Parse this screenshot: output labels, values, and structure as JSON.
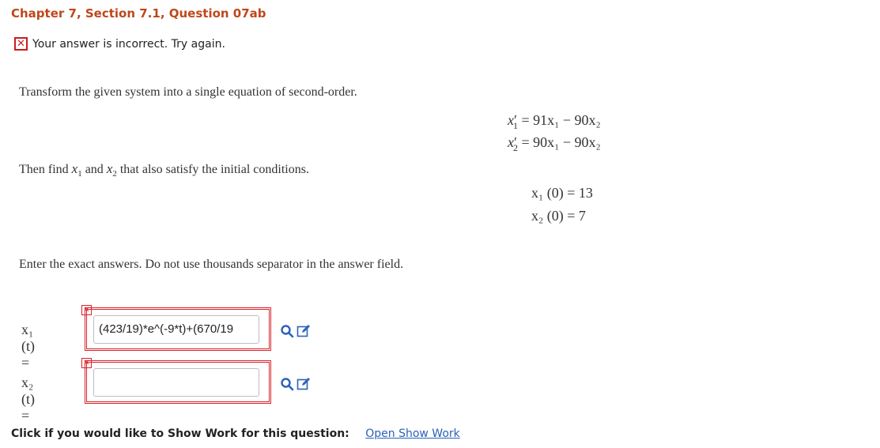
{
  "header": {
    "title": "Chapter 7, Section 7.1, Question 07ab"
  },
  "feedback": {
    "message": "Your answer is incorrect.  Try again."
  },
  "question": {
    "prompt_transform": "Transform the given system into a single equation of second-order.",
    "prompt_find_prefix": "Then find",
    "prompt_find_and": "and",
    "prompt_find_suffix": "that also satisfy the initial conditions.",
    "prompt_exact": "Enter the exact answers. Do not use thousands separator in the answer field.",
    "system": {
      "eq1_rhs": "= 91x₁ − 90x₂",
      "eq2_rhs": "= 90x₁ − 90x₂"
    },
    "initial_conditions": {
      "ic1": "x₁ (0) = 13",
      "ic2": "x₂ (0) = 7"
    }
  },
  "answers": [
    {
      "label": "x₁ (t) =",
      "value": "(423/19)*e^(-9*t)+(670/19",
      "status": "incorrect"
    },
    {
      "label": "x₂ (t) =",
      "value": "",
      "status": "incorrect"
    }
  ],
  "footer": {
    "show_work_prompt": "Click if you would like to Show Work for this question:",
    "show_work_link": "Open Show Work"
  },
  "colors": {
    "title": "#c0471b",
    "error": "#d6242a",
    "link": "#2a62b8"
  }
}
